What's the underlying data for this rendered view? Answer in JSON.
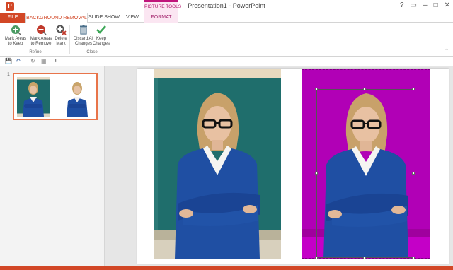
{
  "titlebar": {
    "app_icon_letter": "P",
    "window_title": "Presentation1 - PowerPoint",
    "context_group": "PICTURE TOOLS",
    "controls": [
      "?",
      "▭",
      "–",
      "□",
      "✕"
    ]
  },
  "tabs": {
    "file": "FILE",
    "background_removal": "BACKGROUND REMOVAL",
    "slide_show": "SLIDE SHOW",
    "view": "VIEW",
    "format": "FORMAT"
  },
  "ribbon": {
    "buttons": [
      {
        "label": "Mark Areas\nto Keep",
        "icon": "mark-keep-icon",
        "color": "#4a9b63"
      },
      {
        "label": "Mark Areas\nto Remove",
        "icon": "mark-remove-icon",
        "color": "#c0392b"
      },
      {
        "label": "Delete\nMark",
        "icon": "delete-mark-icon",
        "color": "#555555"
      },
      {
        "label": "Discard All\nChanges",
        "icon": "discard-icon",
        "color": "#4a6f8a"
      },
      {
        "label": "Keep\nChanges",
        "icon": "keep-check-icon",
        "color": "#3aa655"
      }
    ],
    "groups": [
      "Refine",
      "Close"
    ]
  },
  "qat": {
    "save": "💾",
    "undo": "↶",
    "redo": "↻",
    "present": "▦",
    "more": "⬇"
  },
  "slide_panel": {
    "slide_number": "1"
  },
  "colors": {
    "accent": "#d24726",
    "context": "#c0157b",
    "removed_area": "#b100b6",
    "chalkboard": "#1f6e6c"
  }
}
